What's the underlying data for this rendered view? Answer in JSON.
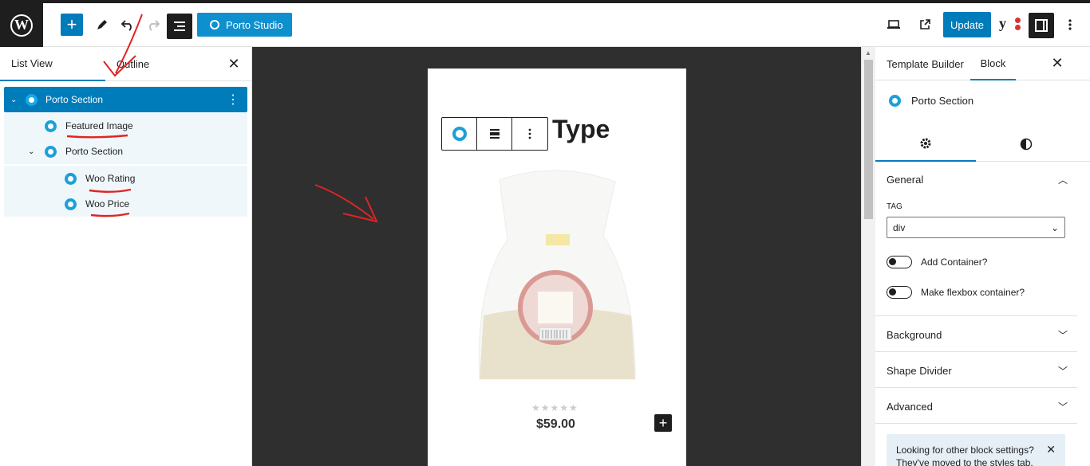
{
  "topbar": {
    "logo_icon": "wordpress-logo-icon",
    "add_icon": "plus-icon",
    "tools_icon": "pencil-icon",
    "undo_icon": "undo-icon",
    "redo_icon": "redo-icon",
    "list_view_icon": "list-view-icon",
    "porto_studio_label": "Porto Studio",
    "view_icon": "laptop-icon",
    "preview_icon": "external-link-icon",
    "update_label": "Update",
    "yoast_icon": "yoast-icon",
    "settings_icon": "sidebar-toggle-icon",
    "options_icon": "more-vertical-icon"
  },
  "left_panel": {
    "tabs": [
      {
        "label": "List View",
        "active": true
      },
      {
        "label": "Outline",
        "active": false
      }
    ],
    "tree": [
      {
        "label": "Porto Section",
        "level": 1,
        "selected": true,
        "expanded": true
      },
      {
        "label": "Featured Image",
        "level": 2,
        "selected": false
      },
      {
        "label": "Porto Section",
        "level": 2,
        "selected": false,
        "expanded": true
      },
      {
        "label": "Woo Rating",
        "level": 3,
        "selected": false
      },
      {
        "label": "Woo Price",
        "level": 3,
        "selected": false
      }
    ]
  },
  "canvas": {
    "heading_text": "Type",
    "price": "$59.00",
    "rating_stars": 5,
    "rating_value": 0
  },
  "right_panel": {
    "tabs": [
      {
        "label": "Template Builder",
        "active": false
      },
      {
        "label": "Block",
        "active": true
      }
    ],
    "block_name": "Porto Section",
    "sections": {
      "general": "General",
      "tag_label": "TAG",
      "tag_value": "div",
      "add_container": "Add Container?",
      "flexbox": "Make flexbox container?",
      "background": "Background",
      "shape_divider": "Shape Divider",
      "advanced": "Advanced"
    },
    "notice": "Looking for other block settings? They've moved to the styles tab."
  },
  "colors": {
    "accent": "#007cba",
    "porto_blue": "#1ca0d8",
    "dark": "#1e1e1e",
    "canvas_bg": "#2f2f2f",
    "annotation_red": "#e02424"
  }
}
